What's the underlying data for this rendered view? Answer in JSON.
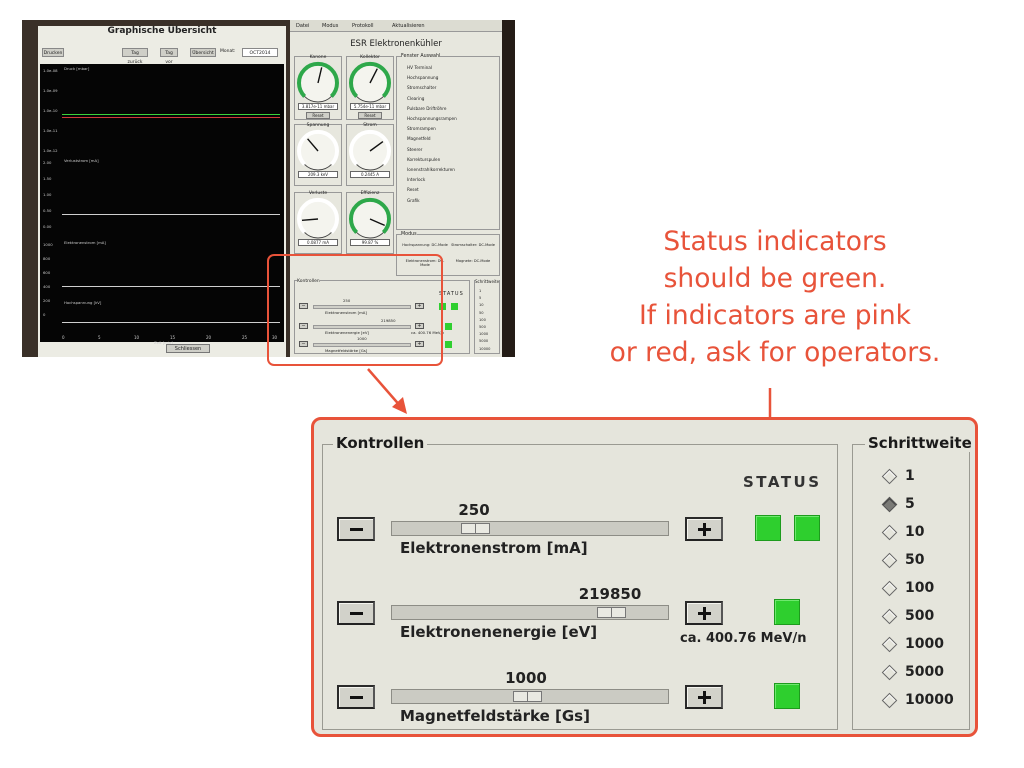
{
  "annotation": {
    "lines": [
      "Status indicators",
      "should be green.",
      "If indicators are pink",
      "or red, ask for operators."
    ]
  },
  "colors": {
    "accent": "#e8533a",
    "status_ok": "#2ecf2e",
    "panel_bg": "#e5e5dc"
  },
  "photo": {
    "left_window": {
      "title": "Graphische Übersicht",
      "buttons": [
        "Drucken",
        "Tag zurück",
        "Tag vor",
        "Übersicht"
      ],
      "monat_label": "Monat:",
      "monat_value": "OCT2014",
      "plot_labels": [
        "Druck [mbar]",
        "Verluststrom [mA]",
        "Elektronenstrom [mA]",
        "Hochspannung [kV]"
      ],
      "y_ticks": [
        "1.0e-08",
        "1.0e-09",
        "1.0e-10",
        "1.0e-11",
        "1.0e-12",
        "2.00",
        "1.50",
        "1.00",
        "0.50",
        "0.00",
        "1000",
        "800",
        "600",
        "400",
        "200",
        "0"
      ],
      "x_ticks": [
        "0",
        "5",
        "10",
        "15",
        "20",
        "25",
        "30"
      ],
      "x_axis_label": "Zeit [min]",
      "close_button": "Schliessen"
    },
    "right_window": {
      "menu": [
        "Datei",
        "Modus",
        "Protokoll",
        "Aktualisieren"
      ],
      "title": "ESR Elektronenkühler",
      "gauges": [
        {
          "label": "Kanone",
          "value": "3.817e-11 mbar",
          "reset": "Reset",
          "level": 0.55,
          "color": "#2ea84a"
        },
        {
          "label": "Kollektor",
          "value": "5.754e-11 mbar",
          "reset": "Reset",
          "level": 0.6,
          "color": "#2ea84a"
        },
        {
          "label": "Spannung",
          "value": "209.3 keV",
          "level": 0.35,
          "color": "#ffffff"
        },
        {
          "label": "Strom",
          "value": "0.2445 A",
          "level": 0.7,
          "color": "#ffffff"
        },
        {
          "label": "Verluste",
          "value": "0.0877 mA",
          "level": 0.15,
          "color": "#ffffff"
        },
        {
          "label": "Effizienz",
          "value": "99.87 %",
          "level": 0.92,
          "color": "#2ea84a"
        }
      ],
      "fenster_title": "Fenster Auswahl",
      "fenster_items": [
        "HV Terminal",
        "Hochspannung",
        "Stromschalter",
        "Clearing",
        "Pulsbare Driftröhre",
        "Hochspannungsrampen",
        "Stromrampen",
        "Magnetfeld",
        "Steerer",
        "Korrekturspulen",
        "Ionenstrahlkorrekturen",
        "Interlock",
        "Reset",
        "Grafik"
      ],
      "modus_title": "Modus",
      "modus_items": [
        "Hochspannung: DC-Mode",
        "Stromschalter: DC-Mode",
        "Elektronenstrom: DC-Mode",
        "Magnete: DC-Mode"
      ],
      "kontrollen_title": "Kontrollen",
      "status_title": "STATUS",
      "slider_values": [
        "250",
        "219850",
        "1000"
      ],
      "slider_labels": [
        "Elektronenstrom [mA]",
        "Elektronenenergie [eV]",
        "Magnetfeldstärke [Gs]"
      ],
      "sub_note": "ca. 400.76 MeV/n",
      "schrittweite_title": "Schrittweite",
      "steps": [
        "1",
        "5",
        "10",
        "50",
        "100",
        "500",
        "1000",
        "5000",
        "10000"
      ]
    }
  },
  "zoom": {
    "kontrollen": {
      "title": "Kontrollen",
      "status_label": "STATUS",
      "sliders": [
        {
          "label": "Elektronenstrom [mA]",
          "value": "250",
          "position": 0.28,
          "indicators": 2,
          "sub": ""
        },
        {
          "label": "Elektronenenergie [eV]",
          "value": "219850",
          "position": 0.83,
          "indicators": 1,
          "sub": "ca. 400.76 MeV/n"
        },
        {
          "label": "Magnetfeldstärke [Gs]",
          "value": "1000",
          "position": 0.49,
          "indicators": 1,
          "sub": ""
        }
      ]
    },
    "schrittweite": {
      "title": "Schrittweite",
      "options": [
        "1",
        "5",
        "10",
        "50",
        "100",
        "500",
        "1000",
        "5000",
        "10000"
      ],
      "selected": "5"
    }
  }
}
